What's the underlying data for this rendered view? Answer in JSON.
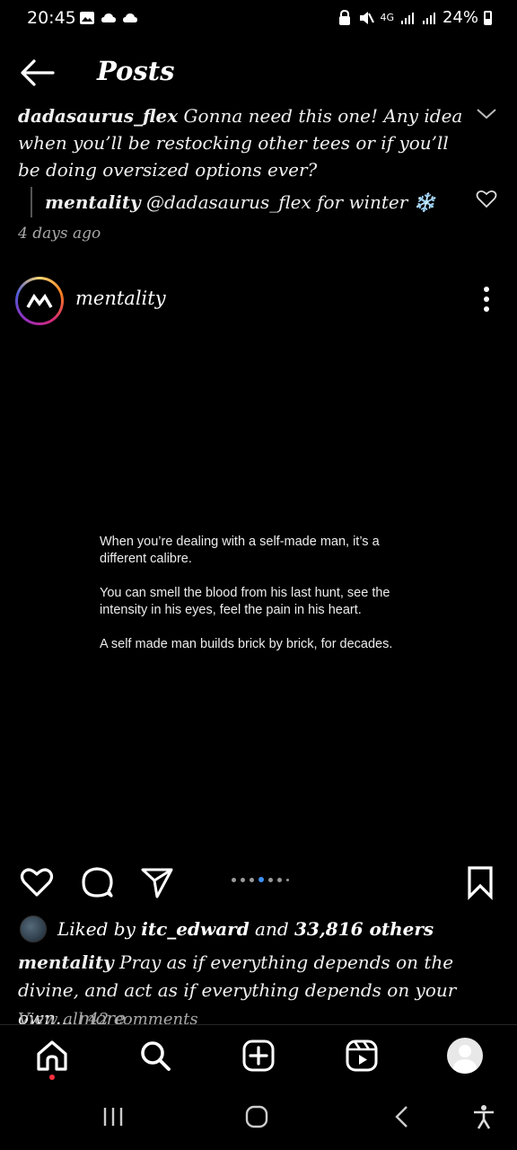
{
  "status_bar": {
    "time": "20:45",
    "network": "4G",
    "battery": "24%",
    "left_icons": [
      "gallery-icon",
      "cloud-icon",
      "cloud-icon"
    ],
    "right_icons": [
      "lock-icon",
      "mute-icon",
      "signal-icon",
      "signal-icon",
      "battery-icon"
    ]
  },
  "header": {
    "title": "Posts"
  },
  "comment": {
    "username": "dadasaurus_flex",
    "text": "Gonna need this one! Any idea when you’ll be restocking other tees or if you’ll be doing oversized options ever?",
    "reply_user": "mentality",
    "reply_text": "@dadasaurus_flex for winter",
    "reply_emoji": "❄️",
    "time_ago": "4 days ago"
  },
  "post": {
    "username": "mentality",
    "image_text": [
      "When you’re dealing with a self-made man, it’s a different calibre.",
      "You can smell the blood from his last hunt, see the intensity in his eyes, feel the pain in his heart.",
      "A self made man builds brick by brick, for decades."
    ],
    "carousel": {
      "total": 7,
      "active_index": 3
    },
    "liked_by_prefix": "Liked by",
    "liked_by_user": "itc_edward",
    "liked_by_and": "and",
    "liked_by_count": "33,816 others",
    "caption_user": "mentality",
    "caption_text": "Pray as if everything depends on the divine, and act as if everything depends on your own...",
    "caption_more": "more",
    "view_comments": "View all 42 comments"
  },
  "bottom_nav": {
    "items": [
      "home-icon",
      "search-icon",
      "create-icon",
      "reels-icon",
      "profile-icon"
    ],
    "notification_color": "#ff3040"
  },
  "colors": {
    "background": "#000000",
    "accent_blue": "#3d91f6",
    "muted": "#a8a8a8"
  }
}
